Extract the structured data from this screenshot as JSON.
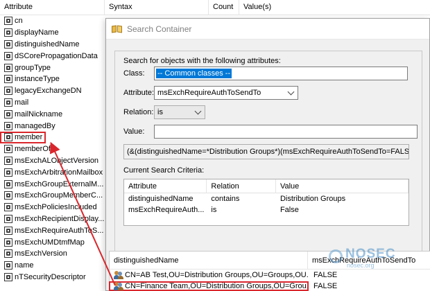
{
  "background": {
    "columns": [
      "Attribute",
      "Syntax",
      "Count",
      "Value(s)"
    ],
    "attributes": [
      "cn",
      "displayName",
      "distinguishedName",
      "dSCorePropagationData",
      "groupType",
      "instanceType",
      "legacyExchangeDN",
      "mail",
      "mailNickname",
      "managedBy",
      "member",
      "memberOf",
      "msExchALObjectVersion",
      "msExchArbitrationMailbox",
      "msExchGroupExternalM...",
      "msExchGroupMemberC...",
      "msExchPoliciesIncluded",
      "msExchRecipientDisplay...",
      "msExchRequireAuthToS...",
      "msExchUMDtmfMap",
      "msExchVersion",
      "name",
      "nTSecurityDescriptor"
    ]
  },
  "dialog": {
    "title": "Search Container",
    "search_heading": "Search for objects with the following attributes:",
    "class_label": "Class:",
    "class_value": "-- Common classes --",
    "attribute_label": "Attribute:",
    "attribute_value": "msExchRequireAuthToSendTo",
    "relation_label": "Relation:",
    "relation_value": "is",
    "value_label": "Value:",
    "value_value": "",
    "query": "(&(distinguishedName=*Distribution Groups*)(msExchRequireAuthToSendTo=FALSE))",
    "criteria_label": "Current Search Criteria:",
    "criteria_columns": [
      "Attribute",
      "Relation",
      "Value"
    ],
    "criteria_rows": [
      [
        "distinguishedName",
        "contains",
        "Distribution Groups"
      ],
      [
        "msExchRequireAuth...",
        "is",
        "False"
      ]
    ]
  },
  "results": {
    "columns": [
      "distinguishedName",
      "msExchRequireAuthToSendTo"
    ],
    "rows": [
      [
        "CN=AB Test,OU=Distribution Groups,OU=Groups,OU...",
        "FALSE"
      ],
      [
        "CN=Finance Team,OU=Distribution Groups,OU=Grou...",
        "FALSE"
      ]
    ]
  },
  "watermark": {
    "brand": "NOSEC",
    "sub": "nosec.org"
  },
  "colors": {
    "accent": "#0078d7",
    "annotation": "#d9262c"
  }
}
